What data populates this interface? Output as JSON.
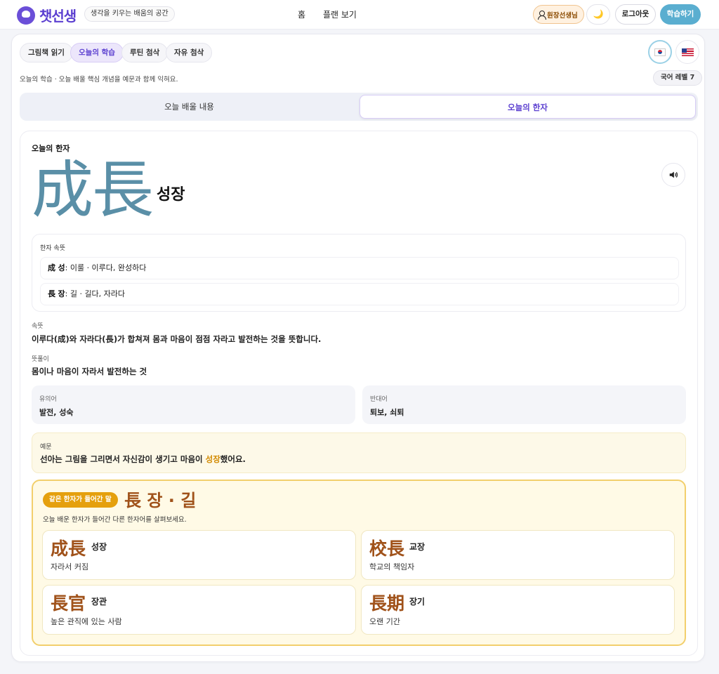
{
  "header": {
    "logo_text": "챗선생",
    "tagline": "생각을 키우는 배움의 공간",
    "nav_home": "홈",
    "nav_plan": "플랜 보기",
    "user_label": "원장선생님",
    "moon_icon": "🌙",
    "logout_label": "로그아웃",
    "study_label": "학습하기"
  },
  "mode_tabs": [
    {
      "label": "그림책 읽기"
    },
    {
      "label": "오늘의 학습"
    },
    {
      "label": "루틴 첨삭"
    },
    {
      "label": "자유 첨삭"
    }
  ],
  "active_mode": "오늘의 학습",
  "subtitle": "오늘의 학습 · 오늘 배울 핵심 개념을 예문과 함께 익혀요.",
  "level_badge": "국어 레벨 7",
  "segments": [
    {
      "label": "오늘 배울 내용"
    },
    {
      "label": "오늘의 한자"
    }
  ],
  "hanja": {
    "panel_label": "오늘의 한자",
    "characters": "成長",
    "reading": "성장",
    "meaning_label": "한자 속뜻",
    "chars": [
      {
        "char": "成",
        "sound": "성",
        "meaning": "이룰 · 이루다, 완성하다"
      },
      {
        "char": "長",
        "sound": "장",
        "meaning": "길 · 길다, 자라다"
      }
    ],
    "inner_label": "속뜻",
    "inner_text": "이루다(成)와 자라다(長)가 합쳐져 몸과 마음이 점점 자라고 발전하는 것을 뜻합니다.",
    "definition_label": "뜻풀이",
    "definition_text": "몸이나 마음이 자라서 발전하는 것",
    "synonym_label": "유의어",
    "synonym_text": "발전, 성숙",
    "antonym_label": "반대어",
    "antonym_text": "퇴보, 쇠퇴",
    "example_label": "예문",
    "example_before": "선아는 그림을 그리면서 자신감이 생기고 마음이 ",
    "example_highlight": "성장",
    "example_after": "했어요."
  },
  "related": {
    "badge": "같은 한자가 들어간 말",
    "head_char": "長",
    "head_reading": "장 · 길",
    "subtitle": "오늘 배운 한자가 들어간 다른 한자어를 살펴보세요.",
    "words": [
      {
        "hanja": "成長",
        "reading": "성장",
        "meaning": "자라서 커짐"
      },
      {
        "hanja": "校長",
        "reading": "교장",
        "meaning": "학교의 책임자"
      },
      {
        "hanja": "長官",
        "reading": "장관",
        "meaning": "높은 관직에 있는 사람"
      },
      {
        "hanja": "長期",
        "reading": "장기",
        "meaning": "오랜 기간"
      }
    ]
  },
  "colors": {
    "brand": "#5b3fd0",
    "hanja_blue": "#5a8fa7",
    "accent_gold": "#e5a00d",
    "related_brown": "#a0521a"
  }
}
